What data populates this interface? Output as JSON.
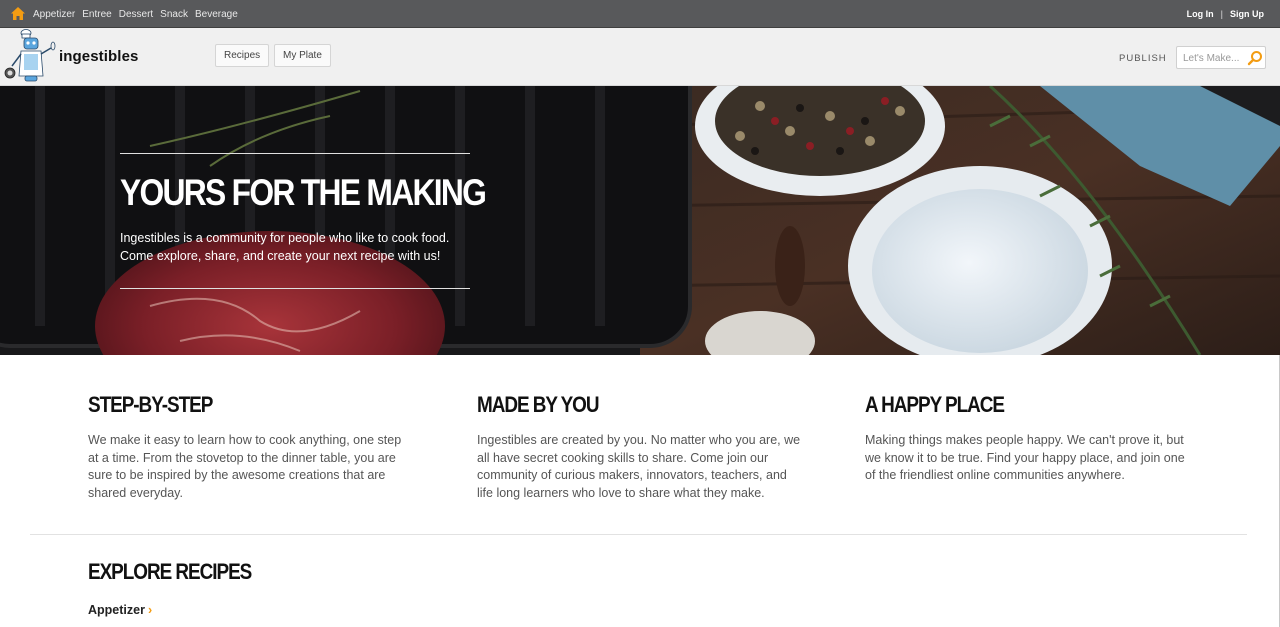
{
  "topbar": {
    "categories": [
      "Appetizer",
      "Entree",
      "Dessert",
      "Snack",
      "Beverage"
    ],
    "login": "Log In",
    "separator": "|",
    "signup": "Sign Up"
  },
  "header": {
    "brand": "ingestibles",
    "nav": {
      "recipes": "Recipes",
      "my_plate": "My Plate"
    },
    "publish": "PUBLISH",
    "search_placeholder": "Let's Make..."
  },
  "hero": {
    "title": "YOURS FOR THE MAKING",
    "subtitle": "Ingestibles is a community for people who like to cook food. Come explore, share, and create your next recipe with us!"
  },
  "features": [
    {
      "title": "STEP-BY-STEP",
      "text": "We make it easy to learn how to cook anything, one step at a time. From the stovetop to the dinner table, you are sure to be inspired by the awesome creations that are shared everyday."
    },
    {
      "title": "MADE BY YOU",
      "text": "Ingestibles are created by you. No matter who you are, we all have secret cooking skills to share. Come join our community of curious makers, innovators, teachers, and life long learners who love to share what they make."
    },
    {
      "title": "A HAPPY PLACE",
      "text": "Making things makes people happy. We can't prove it, but we know it to be true. Find your happy place, and join one of the friendliest online communities anywhere."
    }
  ],
  "explore": {
    "title": "EXPLORE RECIPES",
    "first_category": "Appetizer"
  },
  "colors": {
    "topbar": "#58595b",
    "header": "#f0f0f0",
    "accent": "#f39c12"
  },
  "icons": {
    "home": "home-icon",
    "search": "search-icon",
    "logo": "robot-chef-logo-icon",
    "chevron": "chevron-right-icon"
  }
}
